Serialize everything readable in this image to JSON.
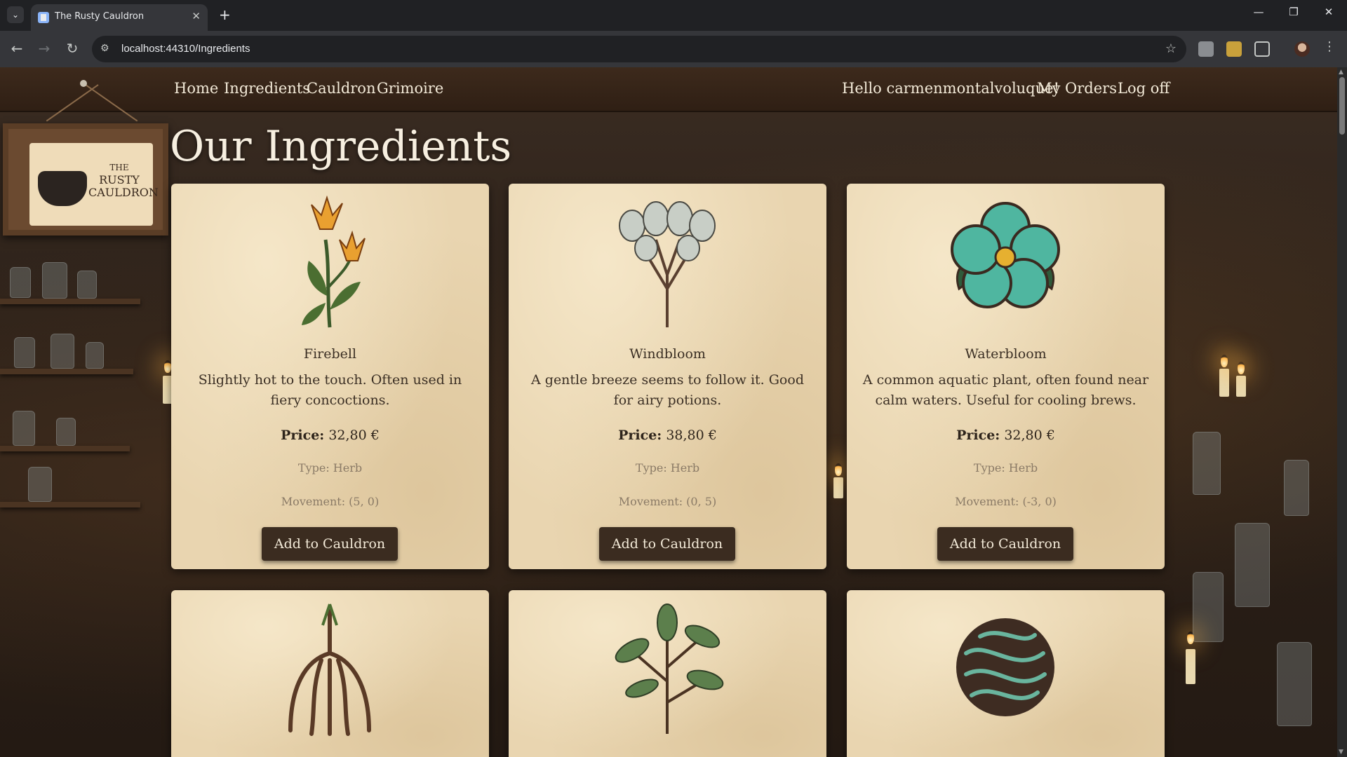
{
  "browser": {
    "tab_title": "The Rusty Cauldron",
    "url": "localhost:44310/Ingredients",
    "tab_close": "✕",
    "new_tab": "+",
    "minimize": "—",
    "restore": "❐",
    "close": "✕"
  },
  "nav": {
    "links": [
      "Home",
      "Ingredients",
      "Cauldron",
      "Grimoire"
    ],
    "greeting": "Hello carmenmontalvoluque!",
    "my_orders": "My Orders",
    "log_off": "Log off"
  },
  "logo": {
    "text_line1": "THE",
    "text_line2": "RUSTY",
    "text_line3": "CAULDRON"
  },
  "page": {
    "title": "Our Ingredients"
  },
  "ingredients": [
    {
      "name": "Firebell",
      "description": "Slightly hot to the touch. Often used in fiery concoctions.",
      "price_label": "Price:",
      "price": "32,80 €",
      "type": "Type: Herb",
      "movement": "Movement: (5, 0)",
      "button": "Add to Cauldron",
      "icon": "firebell-flower-icon"
    },
    {
      "name": "Windbloom",
      "description": "A gentle breeze seems to follow it. Good for airy potions.",
      "price_label": "Price:",
      "price": "38,80 €",
      "type": "Type: Herb",
      "movement": "Movement: (0, 5)",
      "button": "Add to Cauldron",
      "icon": "windbloom-plant-icon"
    },
    {
      "name": "Waterbloom",
      "description": "A common aquatic plant, often found near calm waters. Useful for cooling brews.",
      "price_label": "Price:",
      "price": "32,80 €",
      "type": "Type: Herb",
      "movement": "Movement: (-3, 0)",
      "button": "Add to Cauldron",
      "icon": "waterbloom-flower-icon"
    },
    {
      "icon": "root-icon"
    },
    {
      "icon": "leafy-branch-icon"
    },
    {
      "icon": "moss-icon"
    }
  ],
  "colors": {
    "nav_bg": "#3d2a1c",
    "card_bg": "#e9d5b0",
    "button_bg": "#3b2c20",
    "title_text": "#f7efe0"
  }
}
